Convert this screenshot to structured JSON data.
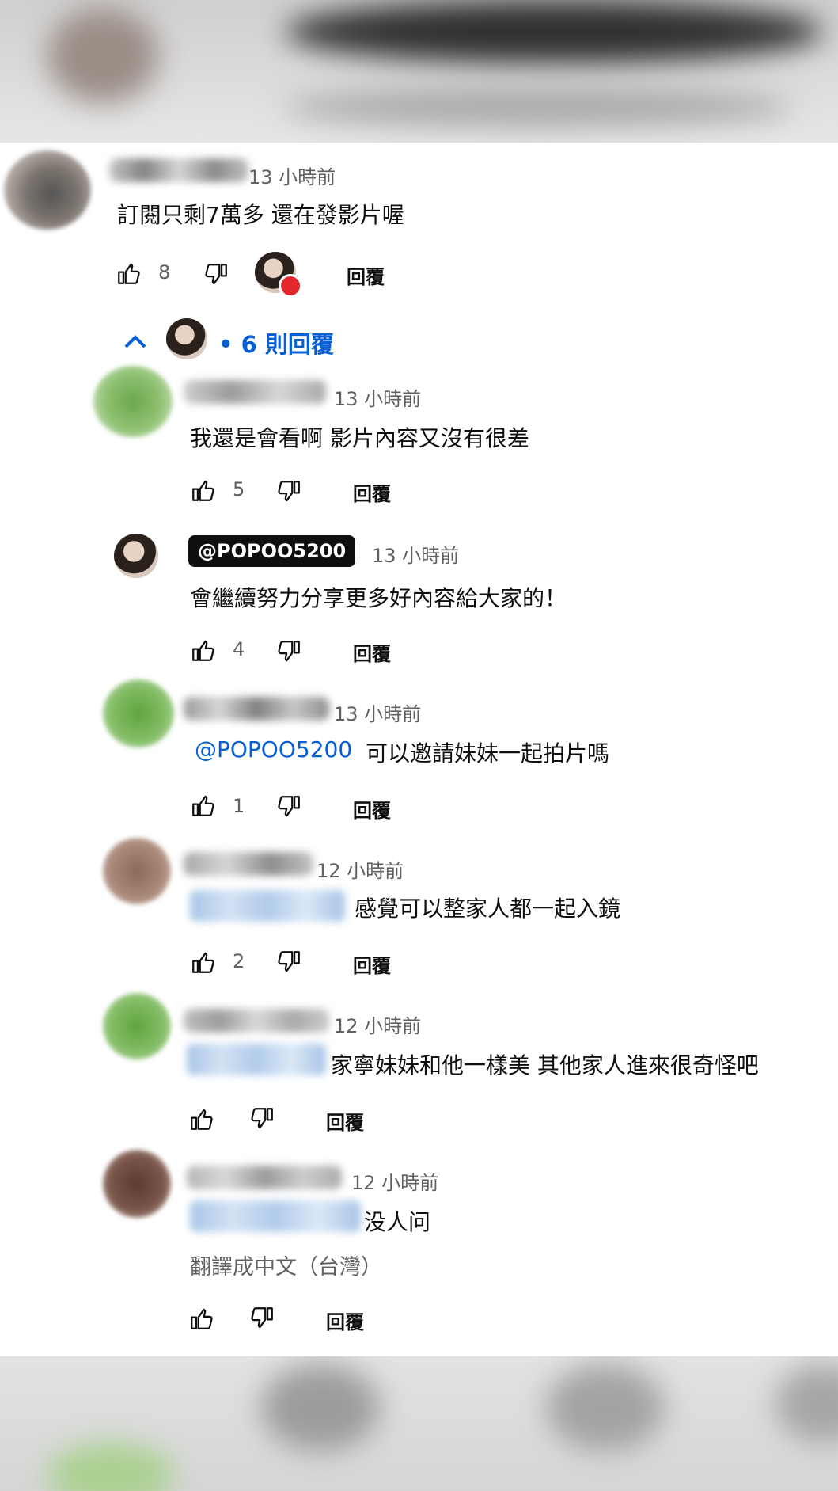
{
  "main_comment": {
    "time": "13 小時前",
    "text": "訂閱只剩7萬多 還在發影片喔",
    "likes": "8",
    "reply_label": "回覆"
  },
  "thread": {
    "toggle_label": "• 6 則回覆"
  },
  "replies": [
    {
      "time": "13 小時前",
      "text": "我還是會看啊 影片內容又沒有很差",
      "likes": "5",
      "reply_label": "回覆"
    },
    {
      "handle": "@POPOO5200",
      "time": "13 小時前",
      "text": "會繼續努力分享更多好內容給大家的！",
      "likes": "4",
      "reply_label": "回覆"
    },
    {
      "time": "13 小時前",
      "mention": "@POPOO5200",
      "text": "可以邀請妹妹一起拍片嗎",
      "likes": "1",
      "reply_label": "回覆"
    },
    {
      "time": "12 小時前",
      "text": "感覺可以整家人都一起入鏡",
      "likes": "2",
      "reply_label": "回覆"
    },
    {
      "time": "12 小時前",
      "text": "家寧妹妹和他一樣美 其他家人進來很奇怪吧",
      "likes": "",
      "reply_label": "回覆"
    },
    {
      "time": "12 小時前",
      "text": "没人问",
      "translate": "翻譯成中文（台灣）",
      "likes": "",
      "reply_label": "回覆"
    }
  ],
  "colors": {
    "link": "#065fd4",
    "text": "#0f0f0f",
    "secondary": "#606060",
    "heart": "#e2272e"
  },
  "icons": [
    "thumbs-up-icon",
    "thumbs-down-icon",
    "chevron-up-icon",
    "heart-icon"
  ]
}
